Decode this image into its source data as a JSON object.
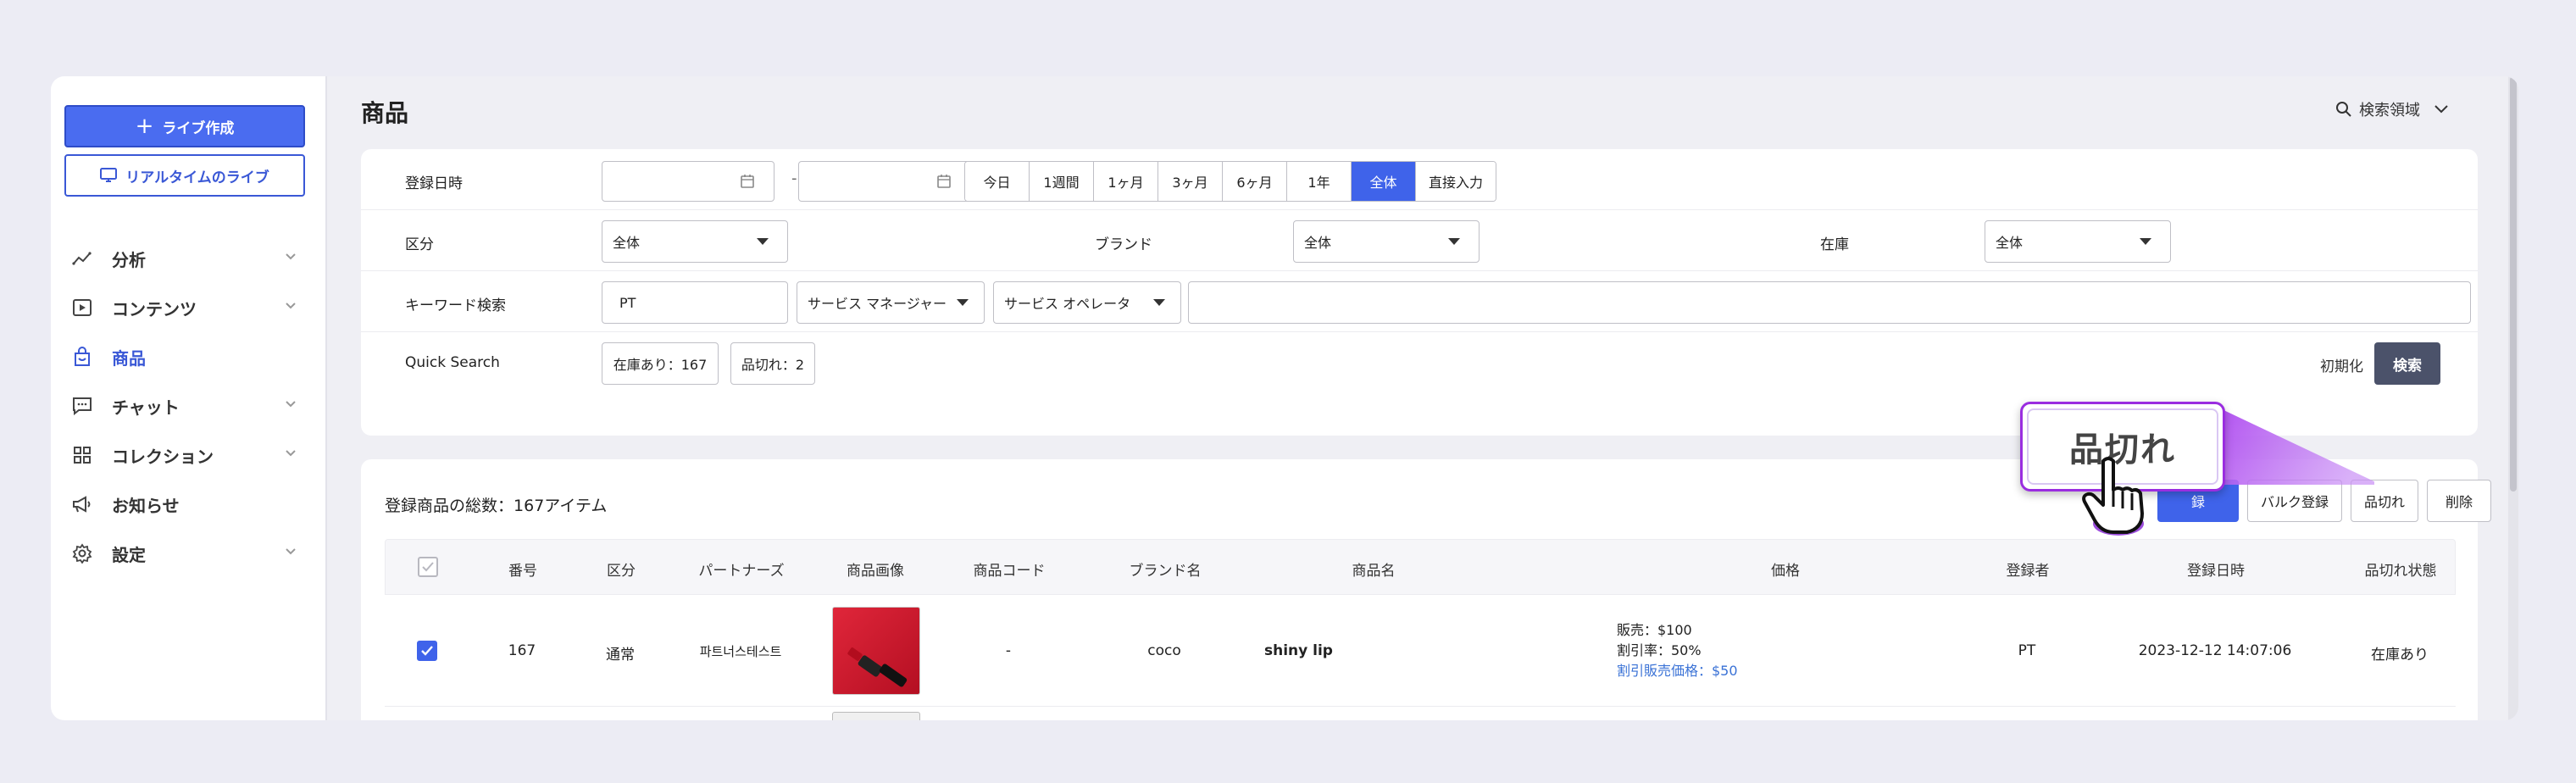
{
  "sidebar": {
    "create_live_label": "ライブ作成",
    "realtime_live_label": "リアルタイムのライブ",
    "items": [
      {
        "label": "分析",
        "icon": "analytics-icon",
        "has_children": true
      },
      {
        "label": "コンテンツ",
        "icon": "play-icon",
        "has_children": true
      },
      {
        "label": "商品",
        "icon": "bag-icon",
        "has_children": false,
        "active": true
      },
      {
        "label": "チャット",
        "icon": "chat-icon",
        "has_children": true
      },
      {
        "label": "コレクション",
        "icon": "grid-icon",
        "has_children": true
      },
      {
        "label": "お知らせ",
        "icon": "megaphone-icon",
        "has_children": false
      },
      {
        "label": "設定",
        "icon": "gear-icon",
        "has_children": true
      }
    ]
  },
  "header": {
    "title": "商品",
    "search_area_label": "検索領域"
  },
  "filters": {
    "date_label": "登録日時",
    "date_separator": "-",
    "date_start_value": "",
    "date_end_value": "",
    "periods": [
      "今日",
      "1週間",
      "1ヶ月",
      "3ヶ月",
      "6ヶ月",
      "1年",
      "全体",
      "直接入力"
    ],
    "active_period": "全体",
    "category_label": "区分",
    "category_value": "全体",
    "brand_label": "ブランド",
    "brand_value": "全体",
    "stock_label": "在庫",
    "stock_value": "全体",
    "keyword_label": "キーワード検索",
    "keyword_value": "PT",
    "service_manager_value": "サービス マネージャー",
    "service_operator_value": "サービス オペレータ",
    "keyword_text_value": "",
    "quick_search_label": "Quick Search",
    "quick_in_stock": "在庫あり：167",
    "quick_sold_out": "品切れ：2",
    "reset_label": "初期化",
    "search_label": "検索"
  },
  "list": {
    "total_label": "登録商品の総数：",
    "total_value": "167アイテム",
    "actions": {
      "register_partial": "録",
      "bulk_register": "バルク登録",
      "sold_out": "品切れ",
      "delete": "削除"
    },
    "columns": [
      "番号",
      "区分",
      "パートナーズ",
      "商品画像",
      "商品コード",
      "ブランド名",
      "商品名",
      "価格",
      "登録者",
      "登録日時",
      "品切れ状態"
    ],
    "rows": [
      {
        "number": "167",
        "category": "通常",
        "partner": "파트너스테스트",
        "code": "-",
        "brand": "coco",
        "name": "shiny lip",
        "price_sale": "販売：$100",
        "price_rate": "割引率：50%",
        "price_discount": "割引販売価格：$50",
        "registrant": "PT",
        "registered_at": "2023-12-12 14:07:06",
        "stock_status": "在庫あり",
        "checked": true
      }
    ]
  },
  "tooltip": {
    "label": "品切れ"
  },
  "colors": {
    "accent": "#3f63ea",
    "tooltip_purple": "#9a2de0",
    "search_button": "#4b526a"
  }
}
